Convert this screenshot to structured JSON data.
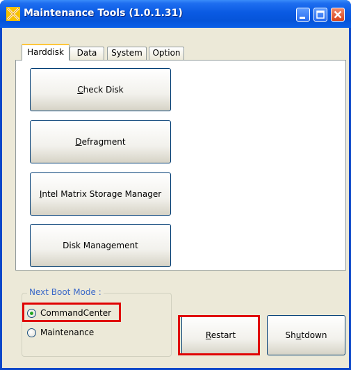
{
  "window": {
    "title": "Maintenance Tools (1.0.1.31)"
  },
  "tabs": [
    {
      "label": "Harddisk",
      "active": true
    },
    {
      "label": "Data",
      "active": false
    },
    {
      "label": "System",
      "active": false
    },
    {
      "label": "Option",
      "active": false
    }
  ],
  "tools": {
    "check_disk": {
      "pre": "",
      "key": "C",
      "post": "heck Disk"
    },
    "defragment": {
      "pre": "",
      "key": "D",
      "post": "efragment"
    },
    "intel_matrix": {
      "pre": "",
      "key": "I",
      "post": "ntel Matrix Storage Manager"
    },
    "disk_management": {
      "pre": "",
      "key": "",
      "post": "Disk Management"
    }
  },
  "boot_mode": {
    "legend": "Next Boot Mode :",
    "options": [
      {
        "label": "CommandCenter",
        "selected": true
      },
      {
        "label": "Maintenance",
        "selected": false
      }
    ]
  },
  "buttons": {
    "restart": {
      "pre": "",
      "key": "R",
      "post": "estart"
    },
    "shutdown": {
      "pre": "Sh",
      "key": "u",
      "post": "tdown"
    }
  },
  "colors": {
    "highlight": "#e00000",
    "title_bar": "#0a5ae3"
  }
}
